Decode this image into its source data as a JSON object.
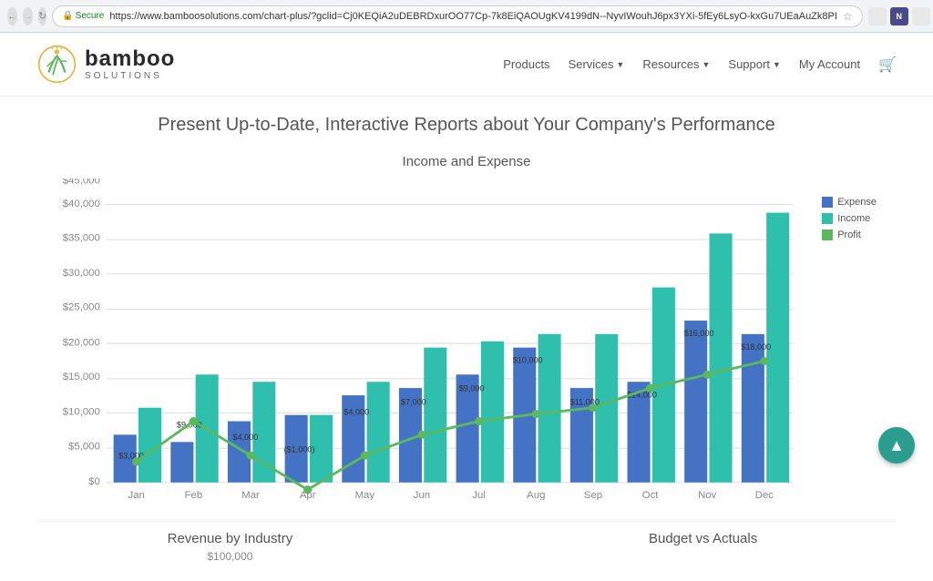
{
  "browser": {
    "url": "https://www.bamboosolutions.com/chart-plus/?gclid=Cj0KEQiA2uDEBRDxurOO77Cp-7k8EiQAOUgKV4199dN--NyvIWouhJ6px3YXi-5fEy6LsyO-kxGu7UEaAuZk8PI",
    "secure_label": "Secure"
  },
  "nav": {
    "logo_name": "bamboo",
    "logo_sub": "solutions",
    "links": [
      {
        "label": "Products",
        "has_dropdown": false
      },
      {
        "label": "Services",
        "has_dropdown": true
      },
      {
        "label": "Resources",
        "has_dropdown": true
      },
      {
        "label": "Support",
        "has_dropdown": true
      },
      {
        "label": "My Account",
        "has_dropdown": false
      }
    ],
    "cart_icon": "🛒"
  },
  "page": {
    "title": "Present Up-to-Date, Interactive Reports about Your Company's Performance"
  },
  "chart": {
    "title": "Income and Expense",
    "legend": [
      {
        "label": "Expense",
        "color": "#4472c4"
      },
      {
        "label": "Income",
        "color": "#2fbfad"
      },
      {
        "label": "Profit",
        "color": "#5cb85c"
      }
    ],
    "months": [
      "Jan",
      "Feb",
      "Mar",
      "Apr",
      "May",
      "Jun",
      "Jul",
      "Aug",
      "Sep",
      "Oct",
      "Nov",
      "Dec"
    ],
    "expense": [
      7000,
      6000,
      9000,
      10000,
      13000,
      14000,
      16000,
      20000,
      14000,
      15000,
      24000,
      22000
    ],
    "income": [
      11000,
      16000,
      15000,
      10000,
      15000,
      20000,
      21000,
      22000,
      22000,
      29000,
      37000,
      40000
    ],
    "profit": [
      3000,
      9000,
      4000,
      -1000,
      4000,
      7000,
      9000,
      10000,
      11000,
      14000,
      16000,
      18000
    ],
    "profit_labels": [
      "$3,000",
      "$9,000",
      "$4,000",
      "($1,000)",
      "$4,000",
      "$7,000",
      "$9,000",
      "$10,000",
      "$11,000",
      "$14,000",
      "$16,000",
      "$18,000"
    ],
    "y_labels": [
      "$0",
      "$5,000",
      "$10,000",
      "$15,000",
      "$20,000",
      "$25,000",
      "$30,000",
      "$35,000",
      "$40,000",
      "$45,000"
    ]
  },
  "bottom": {
    "left_label": "Revenue by Industry",
    "right_label": "Budget vs Actuals",
    "left_sub": "$100,000"
  },
  "scroll_top": "▲"
}
